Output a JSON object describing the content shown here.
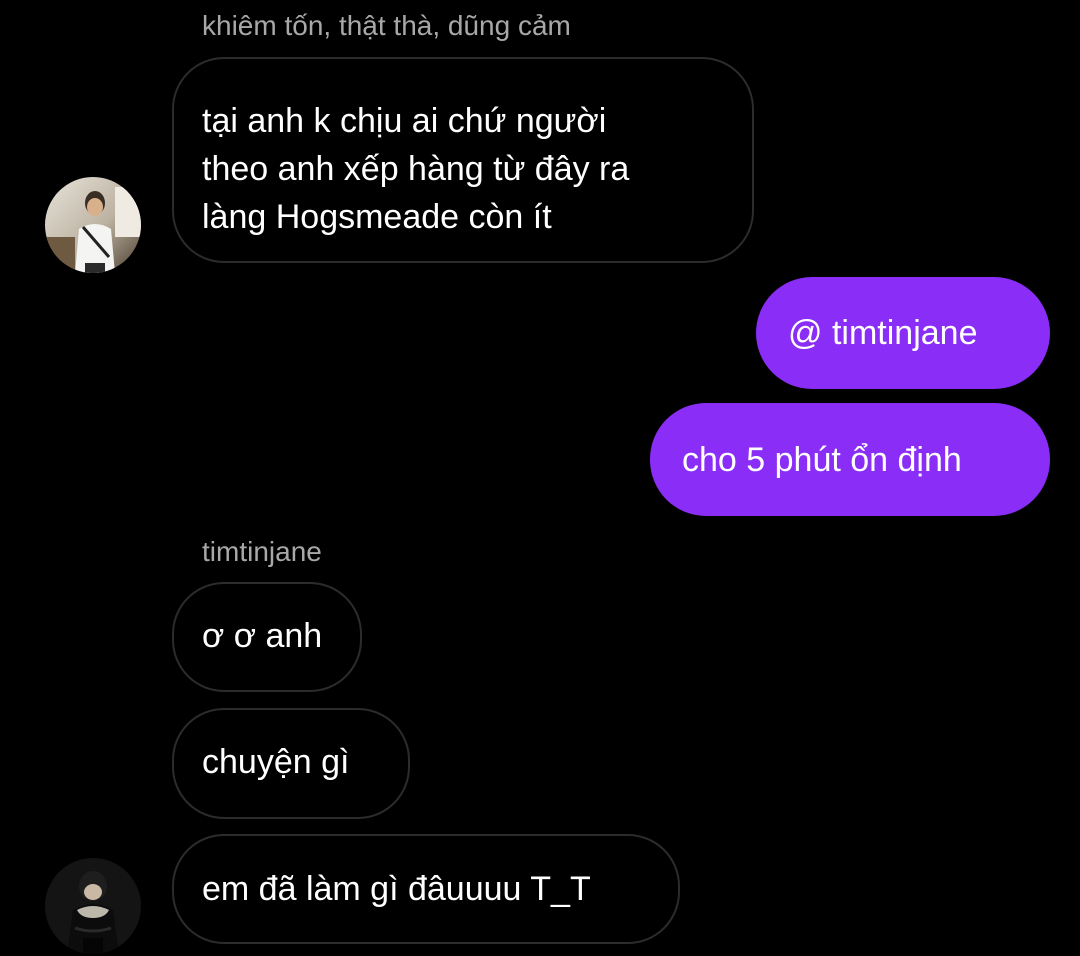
{
  "colors": {
    "background": "#000000",
    "incoming_bubble_border": "#2c2c2c",
    "outgoing_bubble": "#8a2df6",
    "sender_name": "#a8a8a8",
    "text": "#ffffff"
  },
  "thread": {
    "group1": {
      "sender": "khiêm tốn, thật thà, dũng cảm",
      "message_lines": [
        "tại anh k chịu ai chứ người",
        "theo anh xếp hàng từ đây ra",
        "làng Hogsmeade còn ít"
      ],
      "avatar_icon": "user-avatar-photo"
    },
    "outgoing": [
      "@ timtinjane",
      "cho 5 phút ổn định"
    ],
    "group2": {
      "sender": "timtinjane",
      "messages": [
        "ơ ơ anh",
        "chuyện gì",
        "em đã làm gì đâuuuu T_T"
      ],
      "avatar_icon": "user-avatar-photo"
    }
  }
}
